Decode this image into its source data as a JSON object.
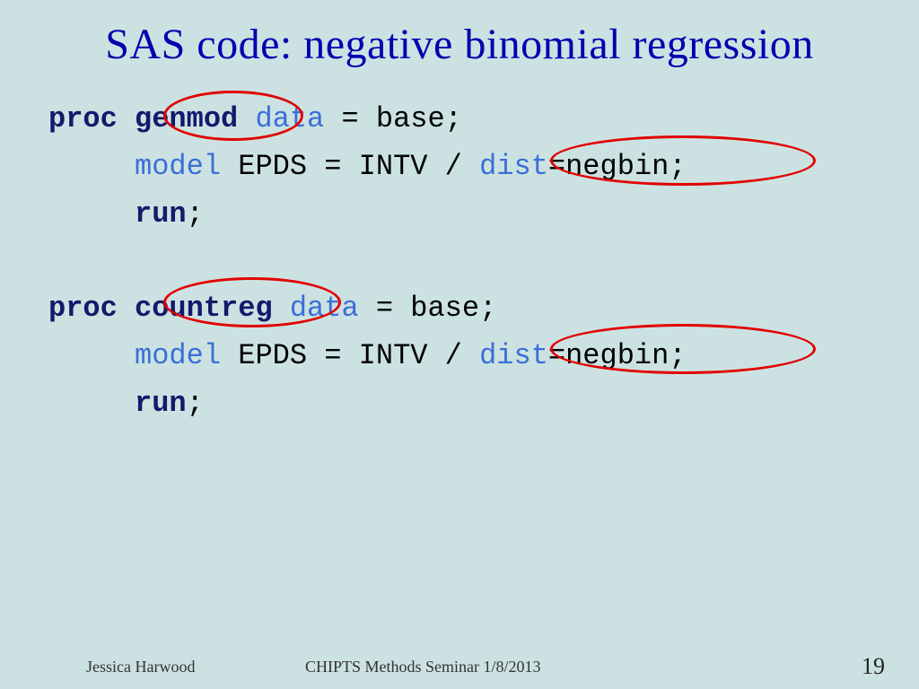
{
  "title": "SAS code: negative binomial regression",
  "code1": {
    "proc": "proc",
    "name": "genmod",
    "datakw": "data",
    "rest1": " = base;",
    "model": "model",
    "mid": " EPDS = INTV / ",
    "dist": "dist",
    "rest2": "=negbin;",
    "run": "run",
    "semi": ";"
  },
  "code2": {
    "proc": "proc",
    "name": "countreg",
    "datakw": "data",
    "rest1": " = base;",
    "model": "model",
    "mid": " EPDS = INTV / ",
    "dist": "dist",
    "rest2": "=negbin;",
    "run": "run",
    "semi": ";"
  },
  "footer": {
    "author": "Jessica Harwood",
    "venue": "CHIPTS Methods Seminar 1/8/2013",
    "page": "19"
  }
}
